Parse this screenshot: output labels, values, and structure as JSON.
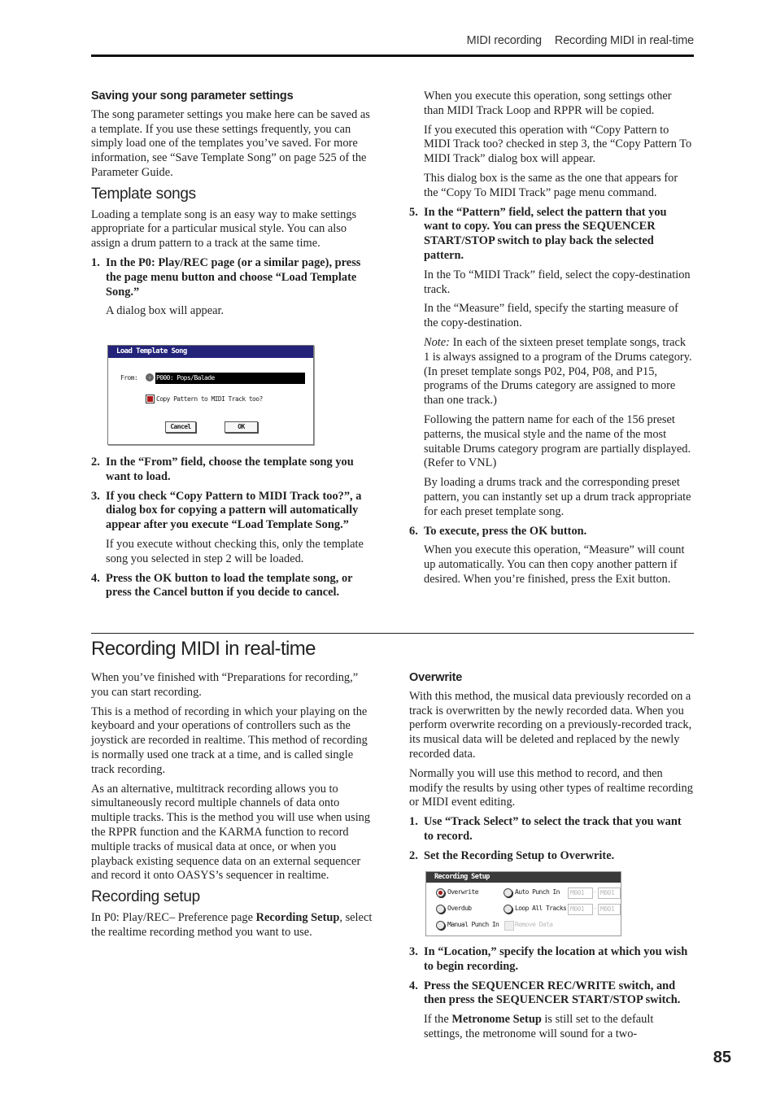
{
  "header": {
    "chapter": "MIDI recording",
    "section": "Recording MIDI in real-time"
  },
  "left_top": {
    "saving_heading": "Saving your song parameter settings",
    "saving_para": "The song parameter settings you make here can be saved as a template. If you use these settings frequently, you can simply load one of the templates you’ve saved. For more information, see “Save Template Song” on page 525 of the Parameter Guide.",
    "template_heading": "Template songs",
    "template_para": "Loading a template song is an easy way to make settings appropriate for a particular musical style. You can also assign a drum pattern to a track at the same time.",
    "step1_num": "1.",
    "step1": "In the P0: Play/REC page (or a similar page), press the page menu button and choose “Load Template Song.”",
    "step1_note": "A dialog box will appear.",
    "dialog": {
      "title": "Load Template Song",
      "from_label": "From:",
      "from_value": "P000: Pops/Balade",
      "checkbox_label": "Copy Pattern to MIDI Track too?",
      "checkbox_checked": true,
      "cancel": "Cancel",
      "ok": "OK"
    },
    "step2_num": "2.",
    "step2": "In the “From” field, choose the template song you want to load.",
    "step3_num": "3.",
    "step3": "If you check “Copy Pattern to MIDI Track too?”, a dialog box for copying a pattern will automatically appear after you execute “Load Template Song.”",
    "step3_note": "If you execute without checking this, only the template song you selected in step 2 will be loaded.",
    "step4_num": "4.",
    "step4": "Press the OK button to load the template song, or press the Cancel button if you decide to cancel."
  },
  "right_top": {
    "p1": "When you execute this operation, song settings other than MIDI Track Loop and RPPR will be copied.",
    "p2": "If you executed this operation with “Copy Pattern to MIDI Track too? checked in step 3, the “Copy Pattern To MIDI Track” dialog box will appear.",
    "p3": "This dialog box is the same as the one that appears for the “Copy To MIDI Track” page menu command.",
    "step5_num": "5.",
    "step5": "In the “Pattern” field, select the pattern that you want to copy. You can press the SEQUENCER START/STOP switch to play back the selected pattern.",
    "p4": "In the To “MIDI Track” field, select the copy-destination track.",
    "p5": "In the “Measure” field, specify the starting measure of the copy-destination.",
    "note_label": "Note:",
    "note_text": " In each of the sixteen preset template songs, track 1 is always assigned to a program of the Drums category. (In preset template songs P02, P04, P08, and P15, programs of the Drums category are assigned to more than one track.)",
    "p6": "Following the pattern name for each of the 156 preset patterns, the musical style and the name of the most suitable Drums category program are partially displayed. (Refer to VNL)",
    "p7": "By loading a drums track and the corresponding preset pattern, you can instantly set up a drum track appropriate for each preset template song.",
    "step6_num": "6.",
    "step6": "To execute, press the OK button.",
    "p8": "When you execute this operation, “Measure” will count up automatically. You can then copy another pattern if desired. When you’re finished, press the Exit button."
  },
  "section_title": "Recording MIDI in real-time",
  "left_bottom": {
    "p1": "When you’ve finished with “Preparations for recording,” you can start recording.",
    "p2": "This is a method of recording in which your playing on the keyboard and your operations of controllers such as the joystick are recorded in realtime. This method of recording is normally used one track at a time, and is called single track recording.",
    "p3": "As an alternative, multitrack recording allows you to simultaneously record multiple channels of data onto multiple tracks. This is the method you will use when using the RPPR function and the KARMA function to record multiple tracks of musical data at once, or when you playback existing sequence data on an external sequencer and record it onto OASYS’s sequencer in realtime.",
    "setup_heading": "Recording setup",
    "setup_pre": "In P0: Play/REC– Preference page ",
    "setup_bold": "Recording Setup",
    "setup_post": ", select the realtime recording method you want to use."
  },
  "right_bottom": {
    "overwrite_heading": "Overwrite",
    "p1": "With this method, the musical data previously recorded on a track is overwritten by the newly recorded data. When you perform overwrite recording on a previously-recorded track, its musical data will be deleted and replaced by the newly recorded data.",
    "p2": "Normally you will use this method to record, and then modify the results by using other types of realtime recording or MIDI event editing.",
    "step1_num": "1.",
    "step1": "Use “Track Select” to select the track that you want to record.",
    "step2_num": "2.",
    "step2": "Set the Recording Setup to Overwrite.",
    "panel": {
      "title": "Recording Setup",
      "options": [
        {
          "label": "Overwrite",
          "selected": true
        },
        {
          "label": "Overdub",
          "selected": false
        },
        {
          "label": "Manual Punch In",
          "selected": false
        },
        {
          "label": "Auto Punch In",
          "selected": false
        },
        {
          "label": "Loop All Tracks",
          "selected": false
        }
      ],
      "remove_data": "Remove Data",
      "auto_punch_from": "M001",
      "auto_punch_to": "M001",
      "loop_from": "M001",
      "loop_to": "M001",
      "dash": "-"
    },
    "step3_num": "3.",
    "step3": "In “Location,” specify the location at which you wish to begin recording.",
    "step4_num": "4.",
    "step4": "Press the SEQUENCER REC/WRITE switch, and then press the SEQUENCER START/STOP switch.",
    "p3_pre": "If the ",
    "p3_bold": "Metronome Setup",
    "p3_post": " is still set to the default settings, the metronome will sound for a two-"
  },
  "page_number": "85"
}
